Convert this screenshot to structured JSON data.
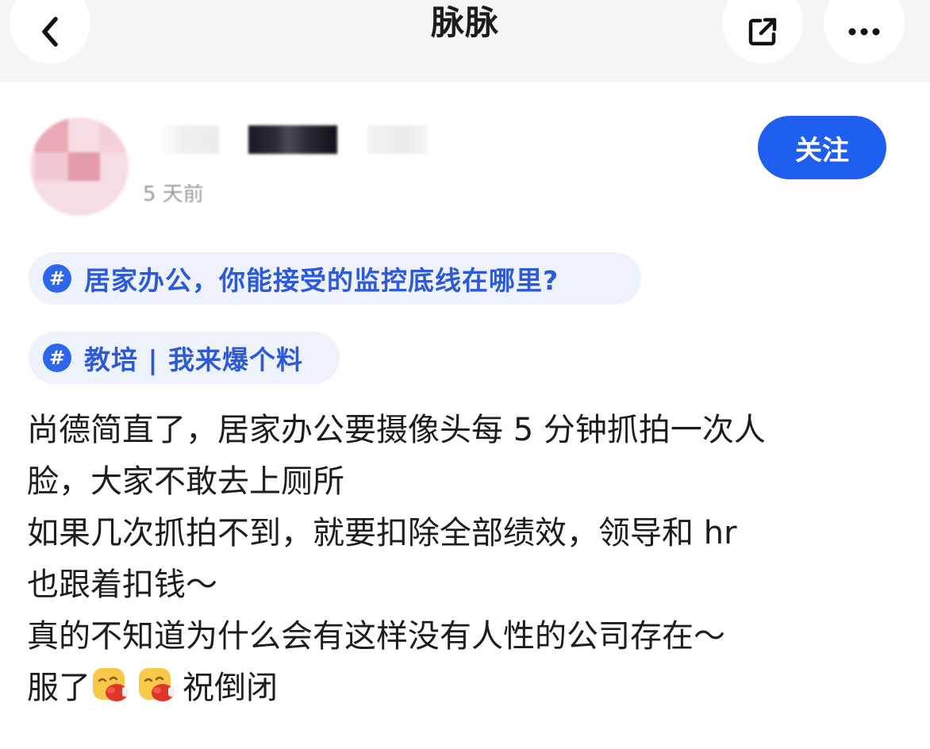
{
  "header": {
    "title": "脉脉",
    "back_icon": "chevron-left-icon",
    "share_icon": "external-link-icon",
    "more_icon": "more-horizontal-icon"
  },
  "author": {
    "post_time": "5 天前",
    "follow_label": "关注"
  },
  "tags": [
    {
      "icon": "#",
      "label": "居家办公，你能接受的监控底线在哪里?"
    },
    {
      "icon": "#",
      "label": "教培 | 我来爆个料"
    }
  ],
  "post": {
    "lines": [
      "尚德简直了，居家办公要摄像头每 5 分钟抓拍一次人",
      "脸，大家不敢去上厕所",
      "如果几次抓拍不到，就要扣除全部绩效，领导和 hr",
      "也跟着扣钱～",
      "真的不知道为什么会有这样没有人性的公司存在～"
    ],
    "last_line_prefix": "服了",
    "last_line_suffix": "祝倒闭",
    "emoji_name": "face-with-boxing-glove-emoji"
  },
  "colors": {
    "accent": "#1e5ff0",
    "tag_bg": "#eef2fb",
    "tag_text": "#2c5ad8",
    "header_bg": "#f4f5f7"
  }
}
